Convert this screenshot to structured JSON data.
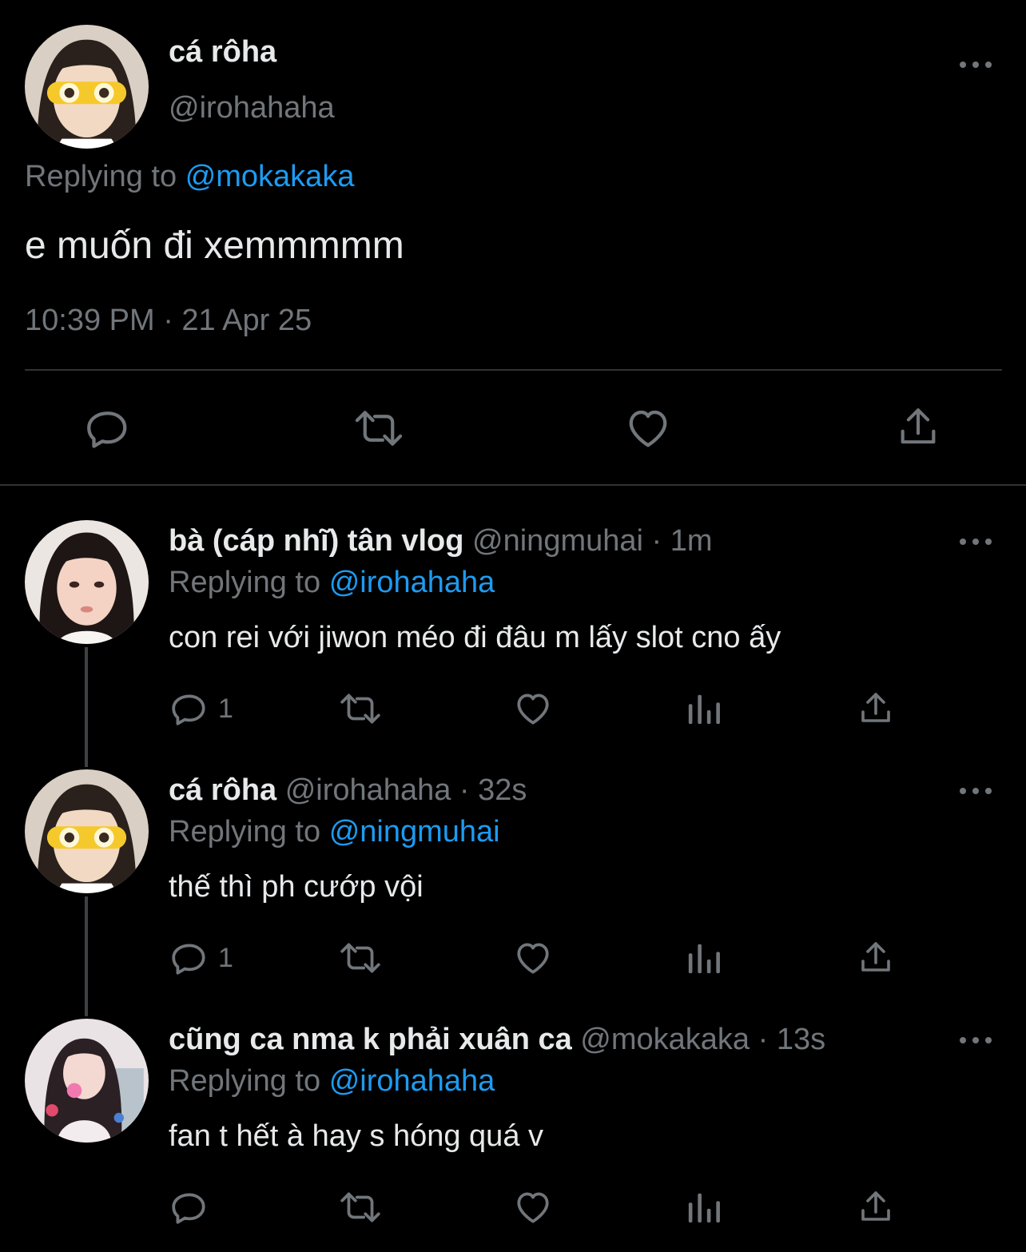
{
  "main_tweet": {
    "display_name": "cá rôha",
    "handle": "@irohahaha",
    "replying_prefix": "Replying to",
    "replying_to": "@mokakaka",
    "text": "e muốn đi xemmmmm",
    "timestamp": "10:39 PM · 21 Apr 25",
    "actions": [
      "reply-icon",
      "retweet-icon",
      "like-icon",
      "share-icon"
    ]
  },
  "replies": [
    {
      "display_name": "bà (cáp nhĩ) tân vlog",
      "meta": "@ningmuhai · 1m",
      "replying_prefix": "Replying to",
      "replying_to": "@irohahaha",
      "text": "con rei với jiwon méo đi đâu m lấy slot cno ấy",
      "reply_count": "1"
    },
    {
      "display_name": "cá rôha",
      "meta": "@irohahaha · 32s",
      "replying_prefix": "Replying to",
      "replying_to": "@ningmuhai",
      "text": "thế thì ph cướp vội",
      "reply_count": "1"
    },
    {
      "display_name": "cũng ca nma k phải xuân ca",
      "meta": "@mokakaka · 13s",
      "replying_prefix": "Replying to",
      "replying_to": "@irohahaha",
      "text": "fan t hết à hay s hóng quá v",
      "reply_count": ""
    }
  ],
  "colors": {
    "background": "#000000",
    "text": "#e7e9ea",
    "muted": "#71767b",
    "link": "#1d9bf0",
    "divider": "#2f3336"
  }
}
